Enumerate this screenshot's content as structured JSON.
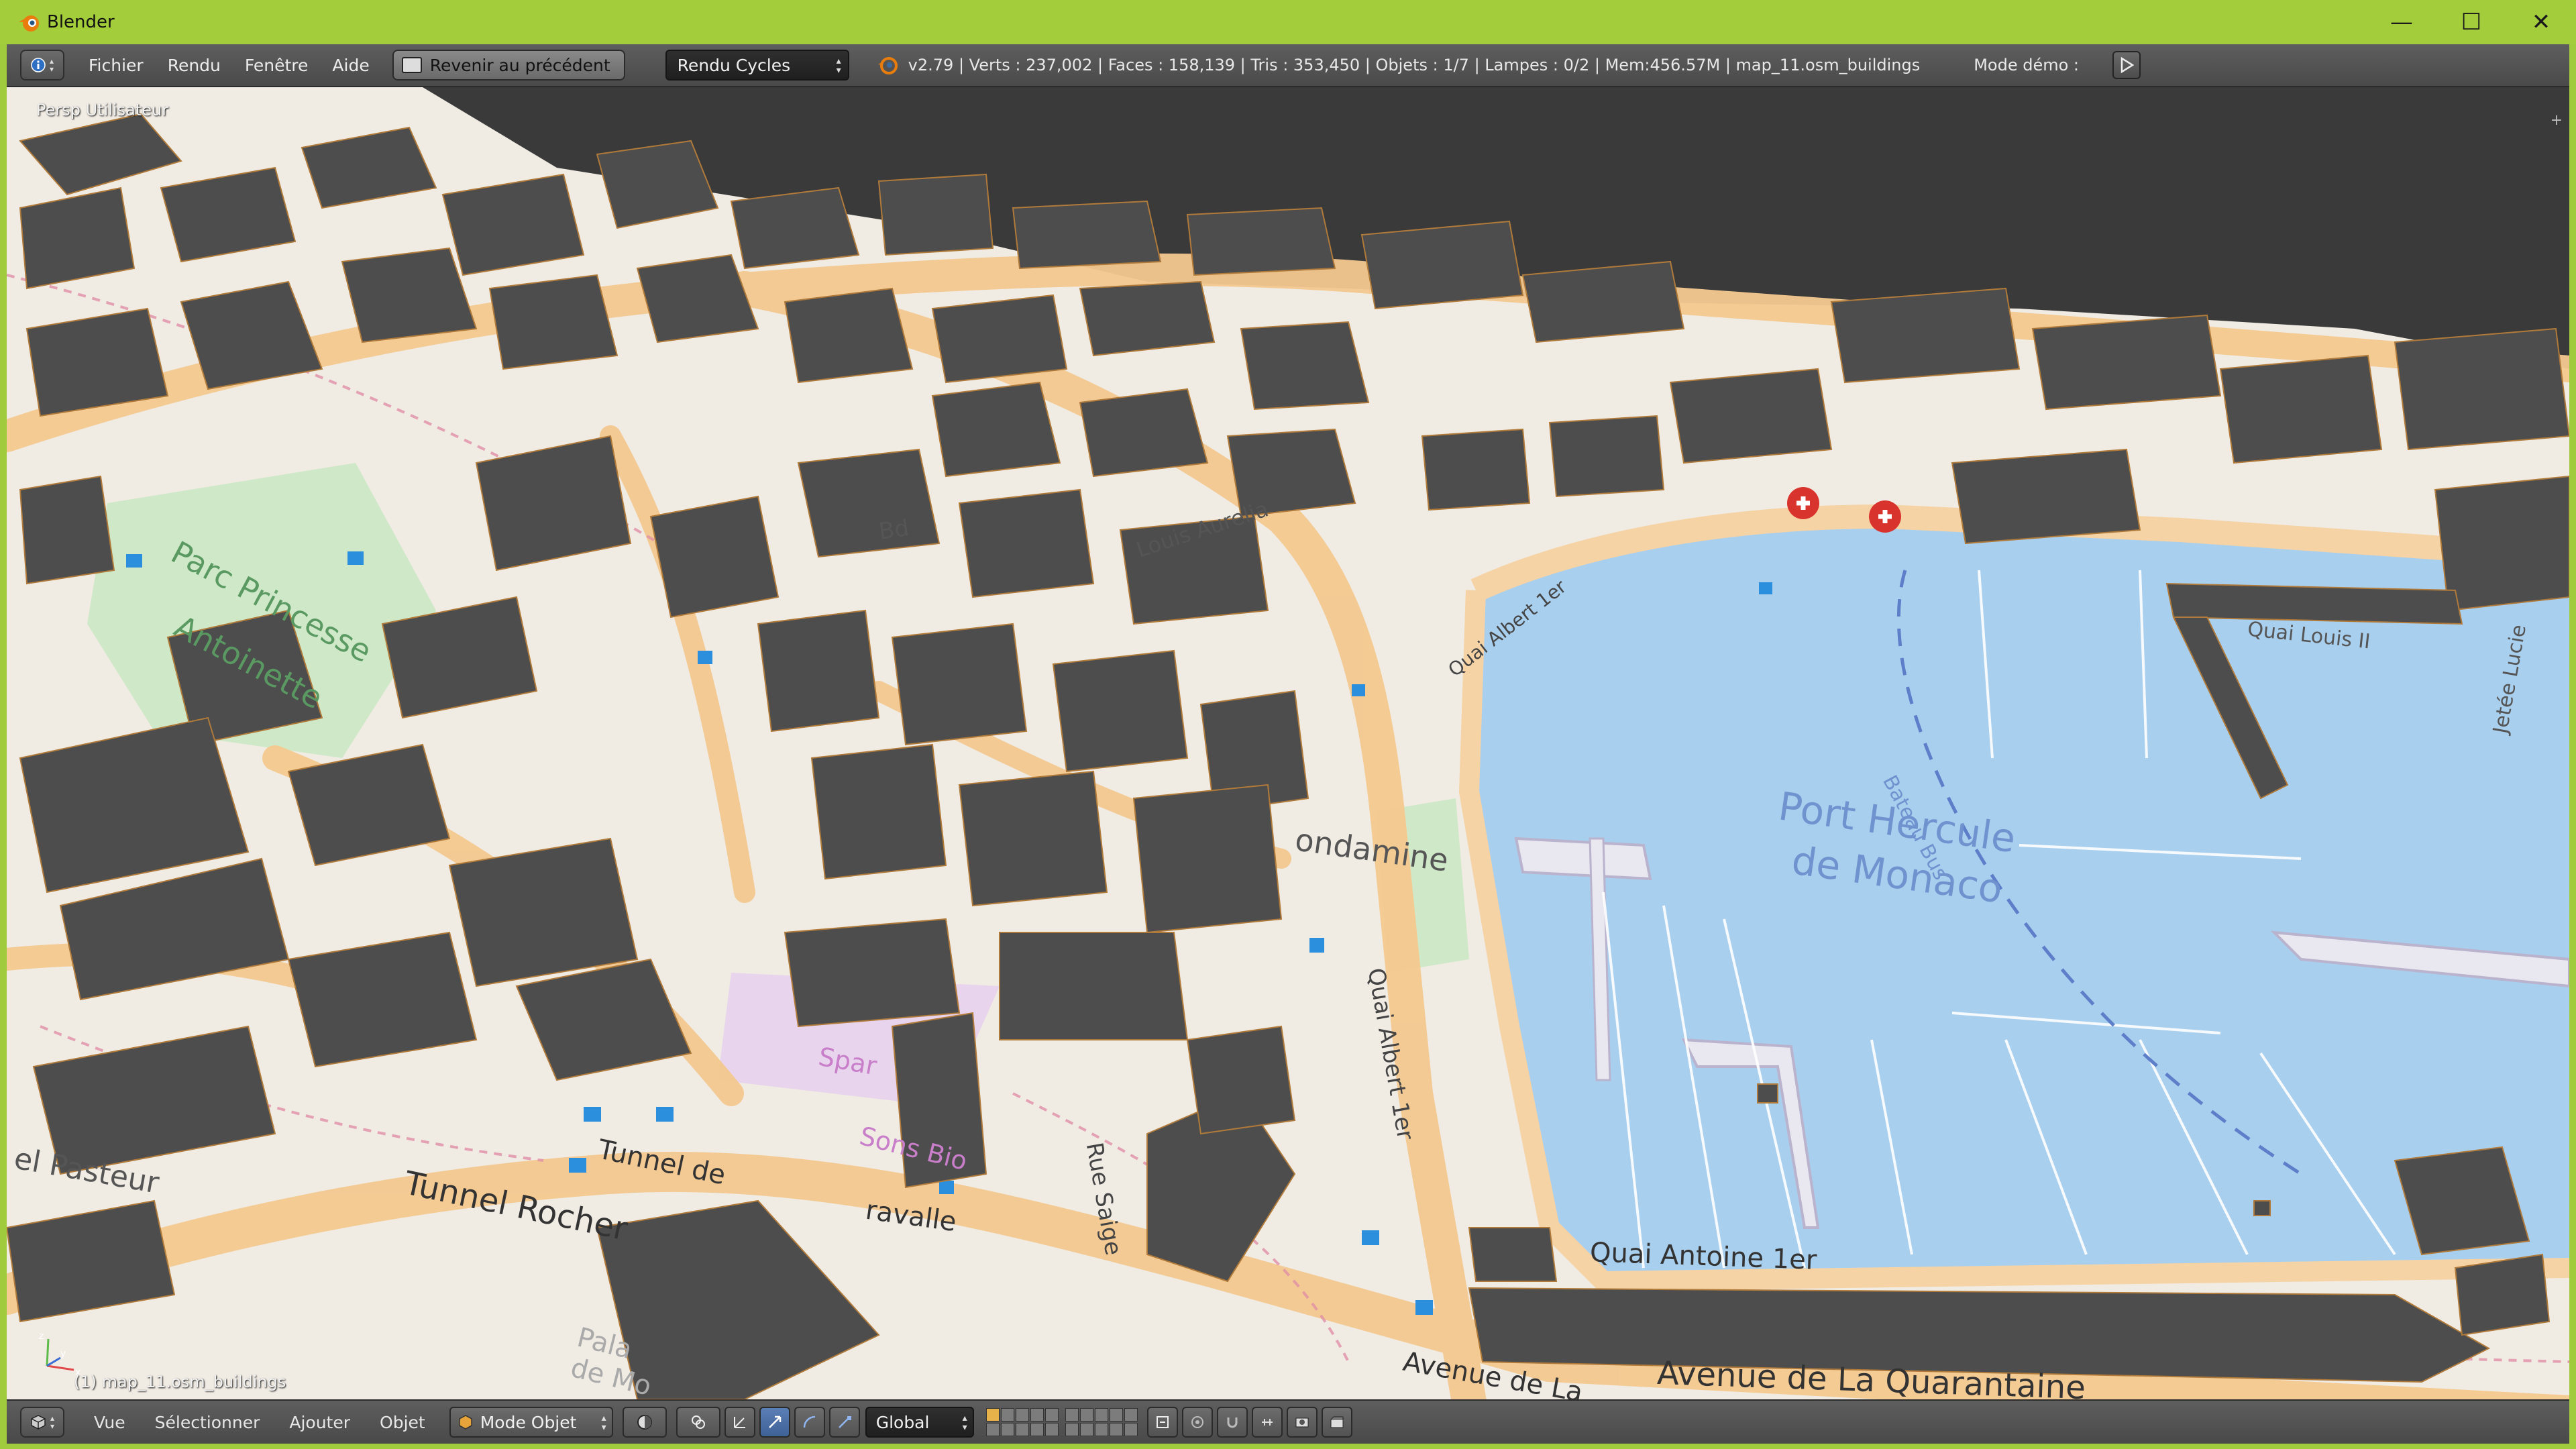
{
  "window": {
    "title": "Blender",
    "controls": {
      "minimize": "—",
      "maximize": "☐",
      "close": "✕"
    }
  },
  "info_header": {
    "menus": [
      "Fichier",
      "Rendu",
      "Fenêtre",
      "Aide"
    ],
    "back_button": "Revenir au précédent",
    "render_engine": "Rendu Cycles",
    "stats": "v2.79 | Verts : 237,002 | Faces : 158,139 | Tris : 353,450 | Objets : 1/7 | Lampes : 0/2 | Mem:456.57M | map_11.osm_buildings",
    "demo_mode_label": "Mode démo :"
  },
  "viewport": {
    "view_label": "Persp Utilisateur",
    "object_label": "(1) map_11.osm_buildings",
    "map_labels": {
      "port": "Port Hercule",
      "port2": "de Monaco",
      "bateau_bus": "Bateau Bus",
      "quai_albert": "Quai Albert 1er",
      "quai_albert_2": "Quai Albert 1er",
      "quai_antoine": "Quai Antoine 1er",
      "avenue_quarantaine": "Avenue de La Quarantaine",
      "avenue_2": "Avenue de La",
      "quai_louis": "Quai Louis II",
      "condamine": "ondamine",
      "parc": "Parc Princesse",
      "parc2": "Antoinette",
      "louis_aurelia": "Louis Aurelia",
      "tunnel": "Tunnel de",
      "tunnel_rocher": "Tunnel Rocher",
      "spar": "Spar",
      "sons_bio": "Sons Bio",
      "ravalle": "ravalle",
      "rue_saige": "Rue Saige",
      "pasteur": "el Pasteur",
      "palais": "Pala",
      "palais2": "de Mo",
      "jetee": "Jetée Lucie",
      "bd": "Bd"
    }
  },
  "bottom_header": {
    "menus": [
      "Vue",
      "Sélectionner",
      "Ajouter",
      "Objet"
    ],
    "mode": "Mode Objet",
    "orientation": "Global"
  },
  "colors": {
    "titlebar": "#a4cd3c",
    "header": "#545454",
    "water": "#a9cfee",
    "land": "#f1ece4",
    "road": "#f6d3a5",
    "park": "#cdebc7",
    "building": "#4d4d4d",
    "map_label": "#7a9bd1"
  }
}
